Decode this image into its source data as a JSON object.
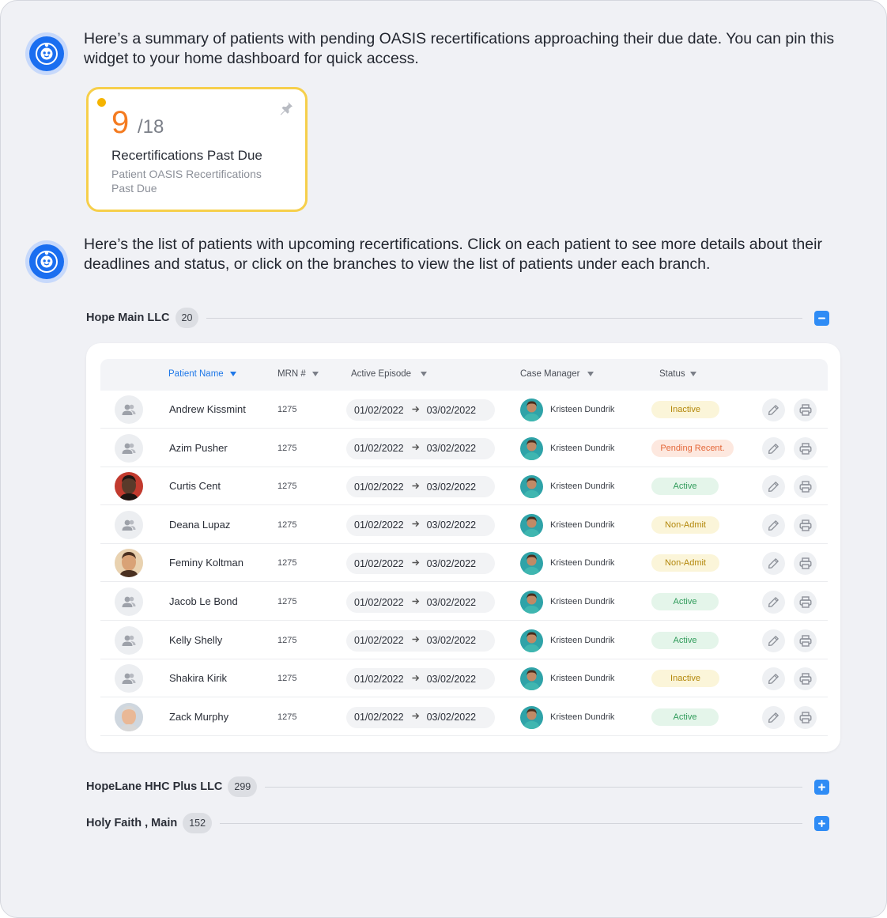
{
  "messages": [
    {
      "text": "Here’s a summary of patients with pending OASIS recertifications approaching their due date. You can pin this widget to your home dashboard for quick access."
    },
    {
      "text": "Here’s the list of patients with upcoming recertifications. Click on each patient to see more details about their deadlines and status, or click on the branches to view the list of patients under each branch."
    }
  ],
  "widget": {
    "count": "9",
    "total": "/18",
    "title": "Recertifications Past Due",
    "subtitle": "Patient OASIS Recertifications Past Due"
  },
  "branches": [
    {
      "name": "Hope Main LLC",
      "count": "20",
      "expanded": true
    },
    {
      "name": "HopeLane HHC Plus LLC",
      "count": "299",
      "expanded": false
    },
    {
      "name": "Holy Faith , Main",
      "count": "152",
      "expanded": false
    }
  ],
  "table": {
    "headers": {
      "patient_name": "Patient Name",
      "mrn": "MRN #",
      "active_episode": "Active Episode",
      "case_manager": "Case Manager",
      "status": "Status"
    },
    "rows": [
      {
        "name": "Andrew Kissmint",
        "mrn": "1275",
        "start": "01/02/2022",
        "end": "03/02/2022",
        "manager": "Kristeen Dundrik",
        "status": "Inactive",
        "avatar": "placeholder"
      },
      {
        "name": "Azim Pusher",
        "mrn": "1275",
        "start": "01/02/2022",
        "end": "03/02/2022",
        "manager": "Kristeen Dundrik",
        "status": "Pending Recent.",
        "avatar": "placeholder"
      },
      {
        "name": "Curtis Cent",
        "mrn": "1275",
        "start": "01/02/2022",
        "end": "03/02/2022",
        "manager": "Kristeen Dundrik",
        "status": "Active",
        "avatar": "photo"
      },
      {
        "name": "Deana Lupaz",
        "mrn": "1275",
        "start": "01/02/2022",
        "end": "03/02/2022",
        "manager": "Kristeen Dundrik",
        "status": "Non-Admit",
        "avatar": "placeholder"
      },
      {
        "name": "Feminy Koltman",
        "mrn": "1275",
        "start": "01/02/2022",
        "end": "03/02/2022",
        "manager": "Kristeen Dundrik",
        "status": "Non-Admit",
        "avatar": "photo"
      },
      {
        "name": "Jacob Le Bond",
        "mrn": "1275",
        "start": "01/02/2022",
        "end": "03/02/2022",
        "manager": "Kristeen Dundrik",
        "status": "Active",
        "avatar": "placeholder"
      },
      {
        "name": "Kelly Shelly",
        "mrn": "1275",
        "start": "01/02/2022",
        "end": "03/02/2022",
        "manager": "Kristeen Dundrik",
        "status": "Active",
        "avatar": "placeholder"
      },
      {
        "name": "Shakira Kirik",
        "mrn": "1275",
        "start": "01/02/2022",
        "end": "03/02/2022",
        "manager": "Kristeen Dundrik",
        "status": "Inactive",
        "avatar": "placeholder"
      },
      {
        "name": "Zack Murphy",
        "mrn": "1275",
        "start": "01/02/2022",
        "end": "03/02/2022",
        "manager": "Kristeen Dundrik",
        "status": "Active",
        "avatar": "photo"
      }
    ]
  },
  "colors": {
    "accent": "#2f8cf5",
    "widget_border": "#f6cf4b",
    "count": "#f47b20",
    "status_active": "#2f9b5a",
    "status_inactive": "#b3870a",
    "status_pending": "#e4683a"
  },
  "icons": [
    "assistant-bot-icon",
    "pin-icon",
    "minus-icon",
    "plus-icon",
    "sort-down-icon",
    "user-placeholder-icon",
    "arrow-right-icon",
    "edit-pencil-icon",
    "print-icon"
  ]
}
